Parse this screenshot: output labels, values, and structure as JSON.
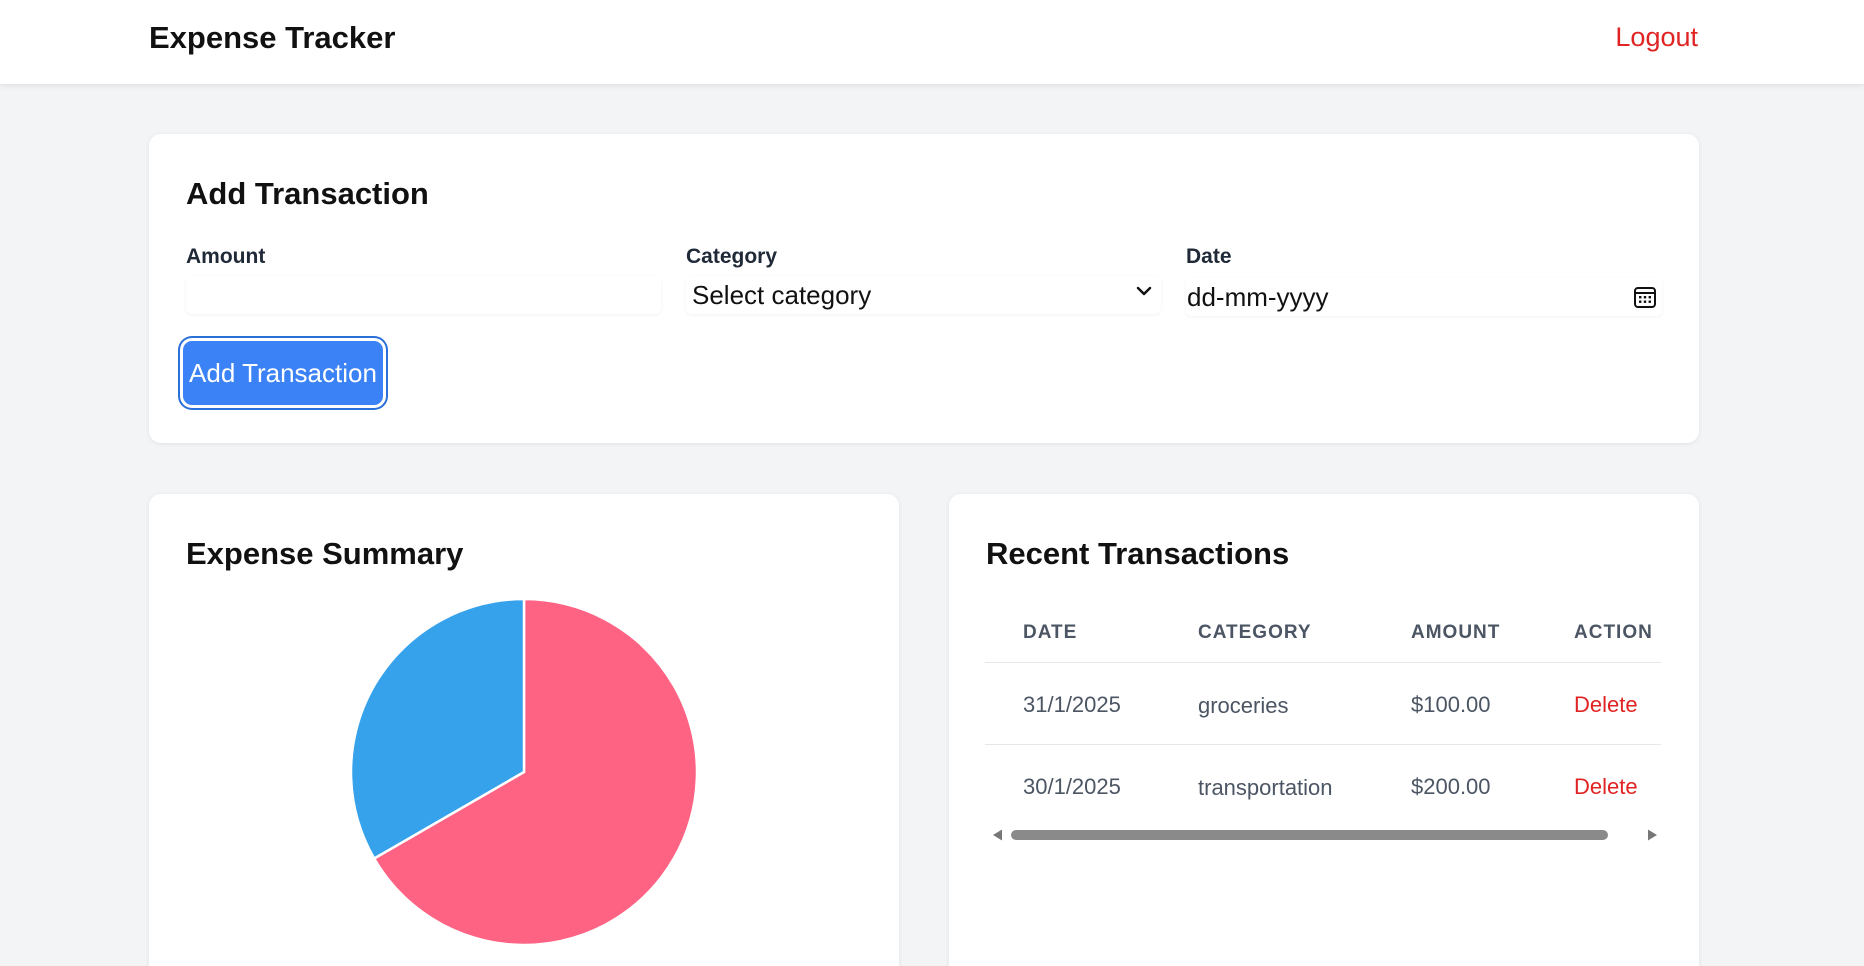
{
  "header": {
    "title": "Expense Tracker",
    "logout_label": "Logout"
  },
  "add_transaction": {
    "title": "Add Transaction",
    "amount_label": "Amount",
    "amount_value": "",
    "category_label": "Category",
    "category_selected": "Select category",
    "date_label": "Date",
    "date_placeholder": "dd-mm-yyyy",
    "submit_label": "Add Transaction"
  },
  "summary": {
    "title": "Expense Summary",
    "chart_data": {
      "type": "pie",
      "categories": [
        "groceries",
        "transportation"
      ],
      "values": [
        100,
        200
      ],
      "colors": [
        "#36a2eb",
        "#ff6384"
      ]
    }
  },
  "recent": {
    "title": "Recent Transactions",
    "columns": [
      "DATE",
      "CATEGORY",
      "AMOUNT",
      "ACTION"
    ],
    "rows": [
      {
        "date": "31/1/2025",
        "category": "groceries",
        "amount": "$100.00",
        "action": "Delete"
      },
      {
        "date": "30/1/2025",
        "category": "transportation",
        "amount": "$200.00",
        "action": "Delete"
      }
    ]
  },
  "icons": {
    "category_select": "chevron-down-icon",
    "date_picker": "calendar-icon",
    "scroll_left": "scroll-left-arrow-icon",
    "scroll_right": "scroll-right-arrow-icon"
  }
}
